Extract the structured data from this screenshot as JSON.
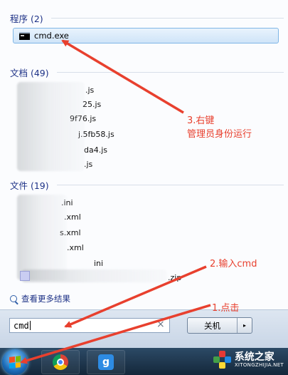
{
  "sections": {
    "programs": {
      "header": "程序 (2)",
      "items": [
        {
          "label": "cmd.exe"
        }
      ]
    },
    "documents": {
      "header": "文档 (49)",
      "items": [
        ".js",
        "25.js",
        "9f76.js",
        "j.5fb58.js",
        "da4.js",
        ".js"
      ]
    },
    "files": {
      "header": "文件 (19)",
      "items": [
        ".ini",
        ".xml",
        "s.xml",
        ".xml",
        "ini",
        ".zip"
      ]
    }
  },
  "more_results": "查看更多结果",
  "search": {
    "value": "cmd",
    "clear_icon": "clear-x-icon"
  },
  "shutdown": {
    "label": "关机",
    "arrow": "▸"
  },
  "annotations": {
    "step3_line1": "3.右键",
    "step3_line2": "管理员身份运行",
    "step2": "2.输入cmd",
    "step1": "1.点击"
  },
  "watermark": {
    "cn": "系统之家",
    "en": "XITONGZHIJIA.NET"
  },
  "colors": {
    "annotation": "#e8402e",
    "header": "#1e3287",
    "highlight": "#cfe4f8"
  }
}
